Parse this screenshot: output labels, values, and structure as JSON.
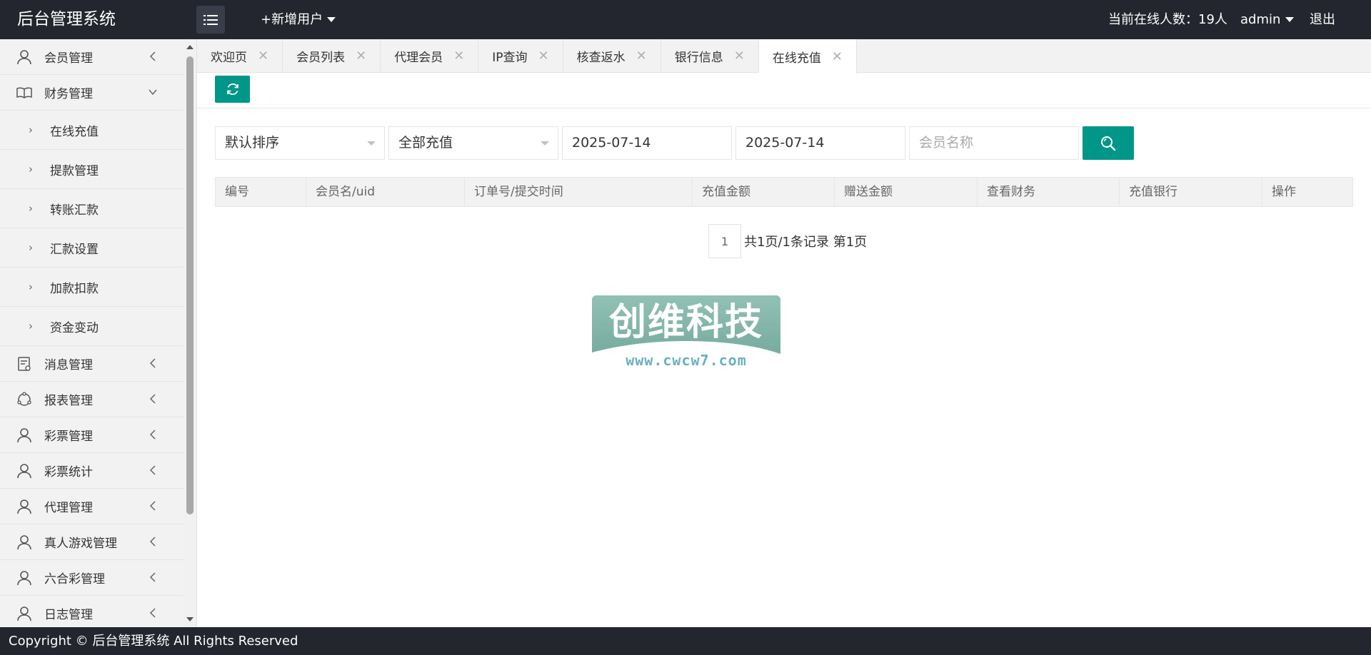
{
  "header": {
    "logo": "后台管理系统",
    "add_user": "+新增用户",
    "online_users": "当前在线人数：19人",
    "admin": "admin",
    "logout": "退出"
  },
  "sidebar": {
    "items": [
      {
        "label": "会员管理",
        "icon": "user-icon",
        "expanded": false
      },
      {
        "label": "财务管理",
        "icon": "book-icon",
        "expanded": true,
        "children": [
          "在线充值",
          "提款管理",
          "转账汇款",
          "汇款设置",
          "加款扣款",
          "资金变动"
        ]
      },
      {
        "label": "消息管理",
        "icon": "message-icon",
        "expanded": false
      },
      {
        "label": "报表管理",
        "icon": "report-icon",
        "expanded": false
      },
      {
        "label": "彩票管理",
        "icon": "user-icon",
        "expanded": false
      },
      {
        "label": "彩票统计",
        "icon": "user-icon",
        "expanded": false
      },
      {
        "label": "代理管理",
        "icon": "user-icon",
        "expanded": false
      },
      {
        "label": "真人游戏管理",
        "icon": "user-icon",
        "expanded": false
      },
      {
        "label": "六合彩管理",
        "icon": "user-icon",
        "expanded": false
      },
      {
        "label": "日志管理",
        "icon": "user-icon",
        "expanded": false
      }
    ]
  },
  "tabs": [
    {
      "label": "欢迎页"
    },
    {
      "label": "会员列表"
    },
    {
      "label": "代理会员"
    },
    {
      "label": "IP查询"
    },
    {
      "label": "核查返水"
    },
    {
      "label": "银行信息"
    },
    {
      "label": "在线充值",
      "active": true
    }
  ],
  "filters": {
    "sort_select": "默认排序",
    "type_select": "全部充值",
    "start_date": "2025-07-14",
    "end_date": "2025-07-14",
    "member_placeholder": "会员名称"
  },
  "table": {
    "columns": [
      "编号",
      "会员名/uid",
      "订单号/提交时间",
      "充值金额",
      "赠送金额",
      "查看财务",
      "充值银行",
      "操作"
    ]
  },
  "pager": {
    "current_page": "1",
    "info": "共1页/1条记录 第1页"
  },
  "watermark": {
    "title": "创维科技",
    "url": "www.cwcw7.com"
  },
  "footer": {
    "copyright": "Copyright © 后台管理系统 All Rights Reserved"
  },
  "colors": {
    "header_bg": "#23262e",
    "accent": "#009688",
    "sidebar_bg": "#f2f2f2"
  }
}
